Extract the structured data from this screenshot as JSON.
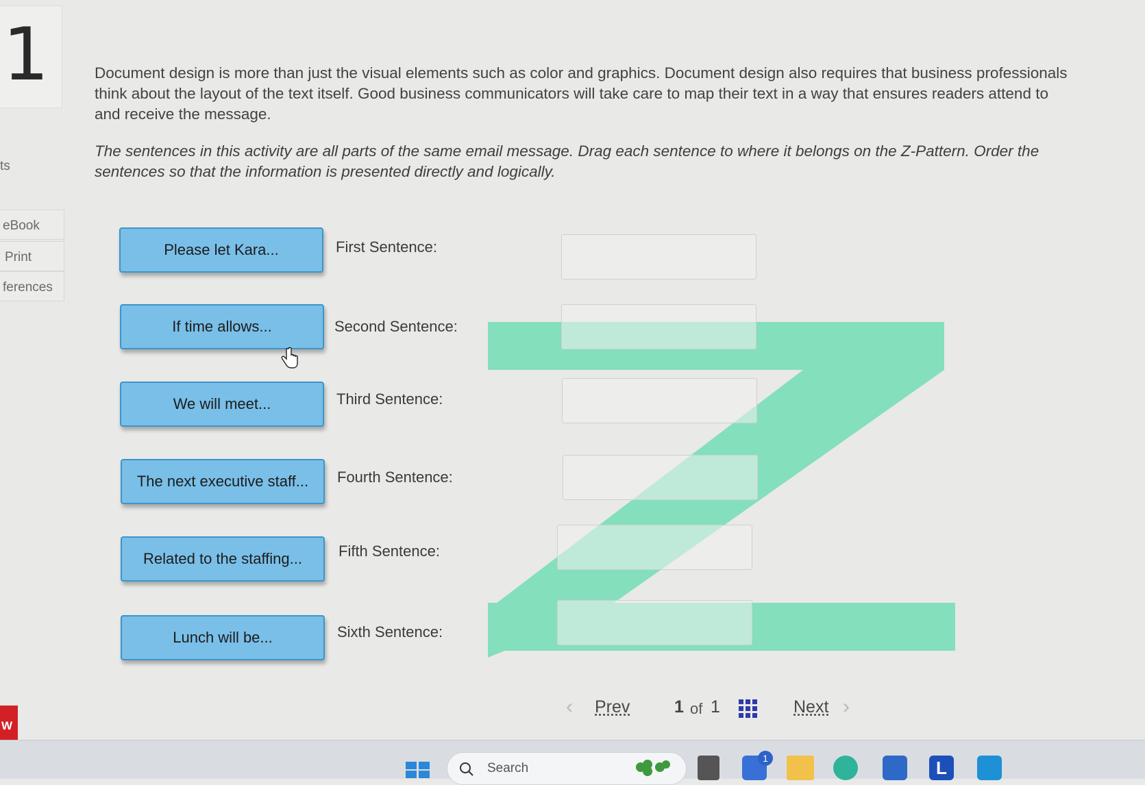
{
  "question": {
    "number": "1"
  },
  "sidebar": {
    "fragment_label": "ts",
    "tabs": [
      {
        "label": "eBook"
      },
      {
        "label": "Print"
      },
      {
        "label": "ferences"
      }
    ],
    "badge_label": "W"
  },
  "content": {
    "intro": "Document design is more than just the visual elements such as color and graphics. Document design also requires that business professionals think about the layout of the text itself. Good business communicators will take care to map their text in a way that ensures readers attend to and receive the message.",
    "instructions": "The sentences in this activity are all parts of the same email message. Drag each sentence to where it belongs on the Z-Pattern. Order the sentences so that the information is presented directly and logically."
  },
  "drag_cards": [
    {
      "label": "Please let Kara..."
    },
    {
      "label": "If time allows..."
    },
    {
      "label": "We will meet..."
    },
    {
      "label": "The next executive staff..."
    },
    {
      "label": "Related to the staffing..."
    },
    {
      "label": "Lunch will be..."
    }
  ],
  "slots": [
    {
      "label": "First Sentence:"
    },
    {
      "label": "Second Sentence:"
    },
    {
      "label": "Third Sentence:"
    },
    {
      "label": "Fourth Sentence:"
    },
    {
      "label": "Fifth Sentence:"
    },
    {
      "label": "Sixth Sentence:"
    }
  ],
  "z_pattern_color": "#84dfbd",
  "pagination": {
    "prev_label": "Prev",
    "current": "1",
    "of_label": "of",
    "total": "1",
    "next_label": "Next"
  },
  "taskbar": {
    "search_placeholder": "Search",
    "notification_count": "1",
    "app_letter": "L"
  }
}
